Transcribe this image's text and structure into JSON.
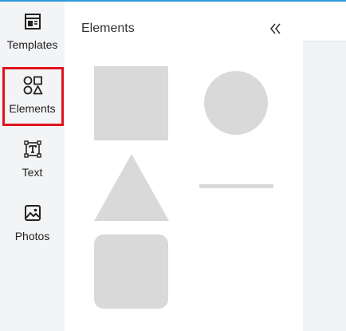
{
  "rail": {
    "items": [
      {
        "label": "Templates",
        "icon": "templates-icon"
      },
      {
        "label": "Elements",
        "icon": "shapes-icon"
      },
      {
        "label": "Text",
        "icon": "text-icon"
      },
      {
        "label": "Photos",
        "icon": "photo-icon"
      }
    ],
    "active": "Elements"
  },
  "panel": {
    "title": "Elements",
    "collapse_icon": "double-chevron-left-icon",
    "shapes": [
      "square",
      "circle",
      "triangle",
      "line",
      "rounded-rectangle"
    ]
  },
  "colors": {
    "accent_top": "#2f98dc",
    "active_outline": "#e0131f",
    "shape_fill": "#d9d9d9"
  }
}
